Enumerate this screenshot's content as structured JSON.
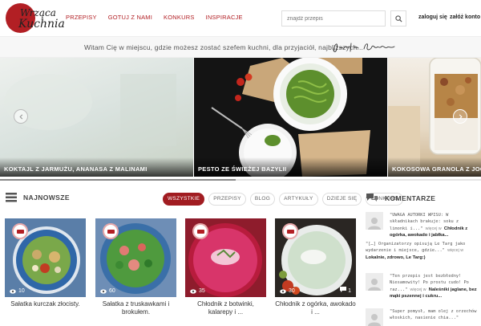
{
  "site": {
    "logo_line1": "Wrząca",
    "logo_line2": "Kuchnia"
  },
  "nav": [
    "PRZEPISY",
    "GOTUJ Z NAMI",
    "KONKURS",
    "INSPIRACJE"
  ],
  "search": {
    "placeholder": "znajdź przepis"
  },
  "account": {
    "login": "zaloguj się",
    "register": "załóż konto"
  },
  "welcome": {
    "text": "Witam Cię w miejscu, gdzie możesz zostać szefem kuchni, dla przyjaciół, najbliższych...",
    "signature": "Jelita Smiłowsky"
  },
  "slider": {
    "slides": [
      {
        "caption": "KOKTAJL Z JARMUŻU, ANANASA Z MALINAMI"
      },
      {
        "caption": "PESTO ZE ŚWIEŻEJ BAZYLII"
      },
      {
        "caption": "KOKOSOWA GRANOLA Z JOGURTEM"
      }
    ],
    "progress": 0.49
  },
  "newest": {
    "title": "NAJNOWSZE",
    "filters": [
      "WSZYSTKIE",
      "PRZEPISY",
      "BLOG",
      "ARTYKUŁY",
      "DZIEJE SIĘ",
      "KONKURS"
    ],
    "active_filter": "WSZYSTKIE",
    "cards": [
      {
        "title": "Sałatka kurczak złocisty.",
        "views": "10",
        "comments": ""
      },
      {
        "title": "Sałatka z truskawkami i brokułem.",
        "views": "60",
        "comments": ""
      },
      {
        "title": "Chłodnik z botwinki, kalarepy i ...",
        "views": "35",
        "comments": ""
      },
      {
        "title": "Chłodnik z ogórka, awokado i ...",
        "views": "30",
        "comments": "1"
      }
    ]
  },
  "comments": {
    "title": "KOMENTARZE",
    "items": [
      {
        "quote": "\"UWAGA AUTORKI WPISU: W składnikach brakuje: soku z limonki i...\"",
        "more": "więcej w",
        "link": "Chłodnik z ogórka, awokado i jabłka..."
      },
      {
        "quote": "\"[…] Organizatorzy opisują Le Targ jako wydarzenie i miejsce, gdzie...\"",
        "more": "więcej w",
        "link": "Lokalnie, zdrowo, Le Targ:)"
      },
      {
        "quote": "\"Ten przepis jest bezbłedny! Niesamowity! Po prostu cudo! Po raz...\"",
        "more": "więcej w",
        "link": "Naleśniki jaglane, bez mąki pszennej i cukru..."
      },
      {
        "quote": "\"Super pomysł, mam olej z orzechów włoskich, nasienie chia...\"",
        "more": "",
        "link": ""
      }
    ]
  },
  "colors": {
    "brand_red": "#b21f24",
    "filter_active": "#a11c21"
  }
}
